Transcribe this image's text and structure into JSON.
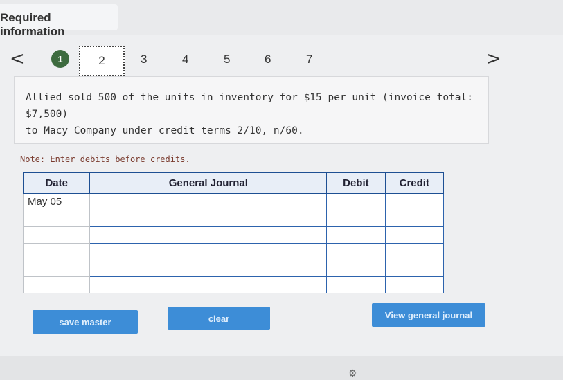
{
  "header": {
    "title": "Required information"
  },
  "nav": {
    "prev_icon": "chevron-left-icon",
    "next_icon": "chevron-right-icon",
    "prev_glyph": "<",
    "next_glyph": ">",
    "steps": [
      "1",
      "2",
      "3",
      "4",
      "5",
      "6",
      "7"
    ],
    "current_step": "2",
    "completed_step": "1"
  },
  "question": {
    "line1": "Allied sold 500 of the units in inventory for $15 per unit (invoice total: $7,500)",
    "line2": "to Macy Company under credit terms 2/10, n/60."
  },
  "note": "Note: Enter debits before credits.",
  "journal": {
    "headers": {
      "date": "Date",
      "account": "General Journal",
      "debit": "Debit",
      "credit": "Credit"
    },
    "rows": [
      {
        "date": "May 05",
        "account": "",
        "debit": "",
        "credit": ""
      },
      {
        "date": "",
        "account": "",
        "debit": "",
        "credit": ""
      },
      {
        "date": "",
        "account": "",
        "debit": "",
        "credit": ""
      },
      {
        "date": "",
        "account": "",
        "debit": "",
        "credit": ""
      },
      {
        "date": "",
        "account": "",
        "debit": "",
        "credit": ""
      },
      {
        "date": "",
        "account": "",
        "debit": "",
        "credit": ""
      }
    ]
  },
  "buttons": {
    "save": "save master",
    "clear": "clear",
    "view": "View general journal"
  },
  "colors": {
    "button_blue": "#3d8dd7",
    "grid_blue": "#2d63ad",
    "done_green": "#3d6b3f"
  }
}
